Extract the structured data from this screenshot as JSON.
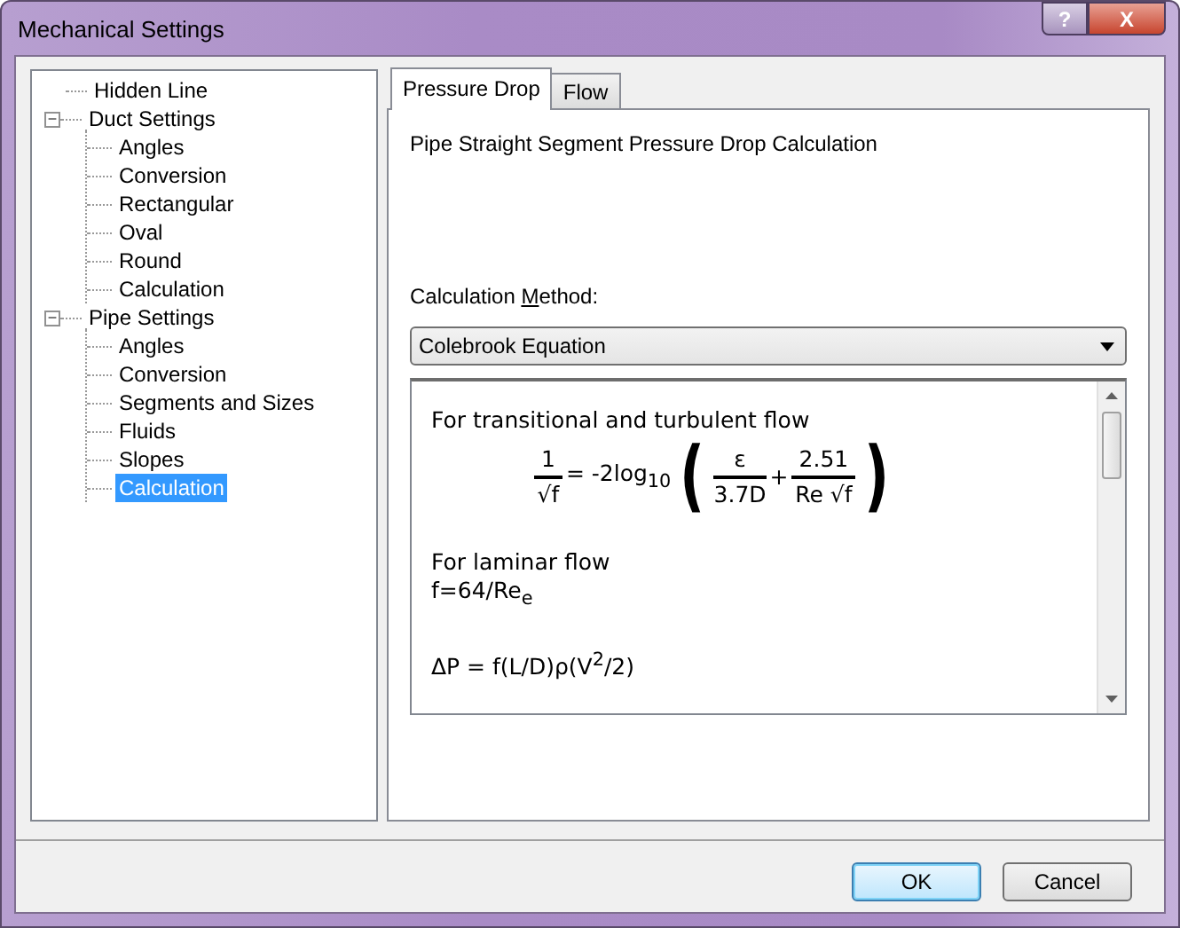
{
  "window": {
    "title": "Mechanical Settings",
    "title_buttons": [
      "?",
      "X"
    ]
  },
  "tree": [
    {
      "label": "Hidden Line",
      "selected": false
    },
    {
      "label": "Duct Settings",
      "selected": false,
      "expanded": true,
      "expander": "−",
      "children": [
        {
          "label": "Angles",
          "selected": false
        },
        {
          "label": "Conversion",
          "selected": false
        },
        {
          "label": "Rectangular",
          "selected": false
        },
        {
          "label": "Oval",
          "selected": false
        },
        {
          "label": "Round",
          "selected": false
        },
        {
          "label": "Calculation",
          "selected": false
        }
      ]
    },
    {
      "label": "Pipe Settings",
      "selected": false,
      "expanded": true,
      "expander": "−",
      "children": [
        {
          "label": "Angles",
          "selected": false
        },
        {
          "label": "Conversion",
          "selected": false
        },
        {
          "label": "Segments and Sizes",
          "selected": false
        },
        {
          "label": "Fluids",
          "selected": false
        },
        {
          "label": "Slopes",
          "selected": false
        },
        {
          "label": "Calculation",
          "selected": true
        }
      ]
    }
  ],
  "tabs": [
    {
      "label": "Pressure Drop",
      "selected": true
    },
    {
      "label": "Flow",
      "selected": false
    }
  ],
  "heading": "Pipe Straight Segment Pressure Drop Calculation",
  "method": {
    "label_before": "Calculation ",
    "label_key": "M",
    "label_after": "ethod:",
    "value": "Colebrook Equation"
  },
  "formula_box": {
    "intro": "For transitional and turbulent flow",
    "lhs": {
      "num": "1",
      "den": "√f"
    },
    "op": "= -2log$_{10}$",
    "open": "(",
    "terms": [
      {
        "num": "ε",
        "den": "3.7D"
      },
      {
        "num": "2.51",
        "den": "Re √f"
      }
    ],
    "join": "+",
    "close": ")",
    "paragraphs": [
      [
        "For laminar flow",
        "f=64/Re$_{e}$"
      ],
      [
        "ΔP = f(L/D)ρ(V$^{2}$/2)"
      ]
    ]
  },
  "buttons": [
    {
      "label": "OK",
      "default": true
    },
    {
      "label": "Cancel",
      "default": false
    }
  ]
}
